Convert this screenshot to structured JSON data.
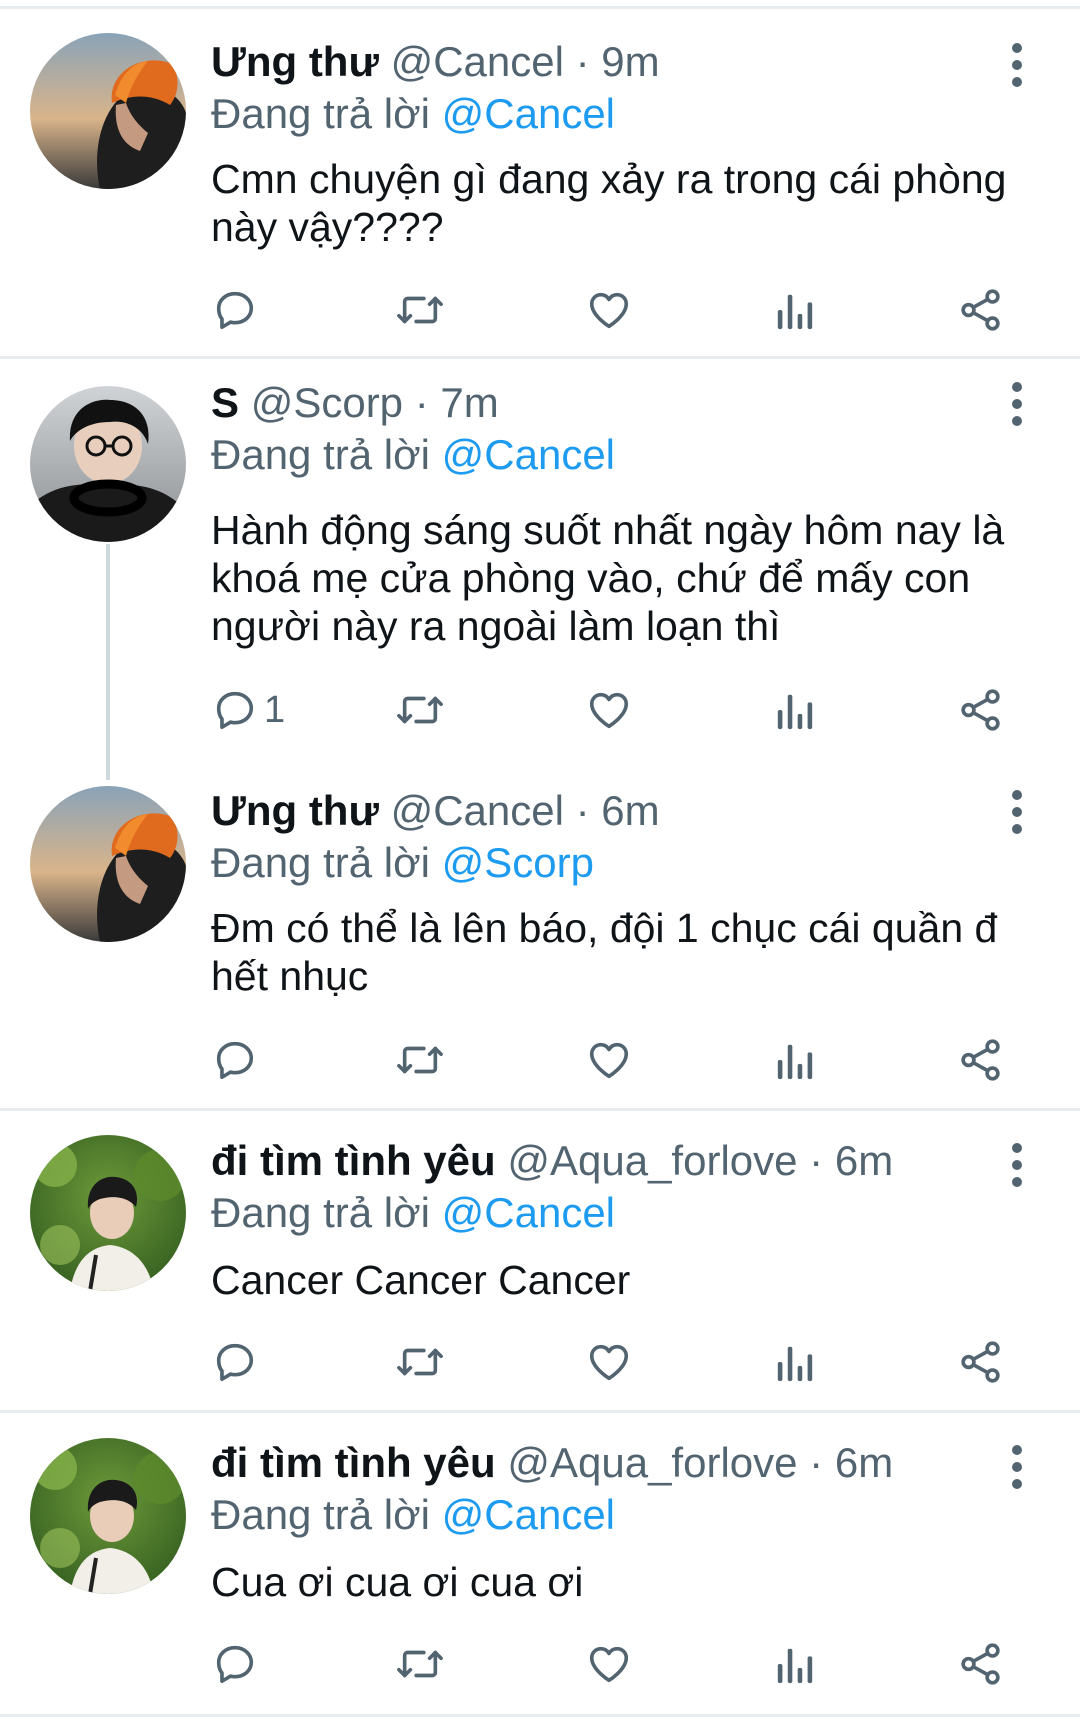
{
  "tweets": [
    {
      "name": "Ưng thư",
      "handle": "@Cancel",
      "separator": "·",
      "time": "9m",
      "replying_label": "Đang trả lời",
      "replying_to": "@Cancel",
      "text": "Cmn chuyện gì đang xảy ra trong cái phòng này vậy????",
      "reply_count": "",
      "avatar_icon": "avatar-orange-hair"
    },
    {
      "name": "S",
      "handle": "@Scorp",
      "separator": "·",
      "time": "7m",
      "replying_label": "Đang trả lời",
      "replying_to": "@Cancel",
      "text": "Hành động sáng suốt nhất ngày hôm nay là khoá mẹ cửa phòng vào, chứ để mấy con người này ra ngoài làm loạn thì",
      "reply_count": "1",
      "avatar_icon": "avatar-glasses"
    },
    {
      "name": "Ưng thư",
      "handle": "@Cancel",
      "separator": "·",
      "time": "6m",
      "replying_label": "Đang trả lời",
      "replying_to": "@Scorp",
      "text": "Đm có thể là lên báo, đội 1 chục cái quần đ hết nhục",
      "reply_count": "",
      "avatar_icon": "avatar-orange-hair"
    },
    {
      "name": "đi tìm tình yêu",
      "handle": "@Aqua_forlove",
      "separator": "·",
      "time": "6m",
      "replying_label": "Đang trả lời",
      "replying_to": "@Cancel",
      "text": "Cancer Cancer Cancer",
      "reply_count": "",
      "avatar_icon": "avatar-green-trees"
    },
    {
      "name": "đi tìm tình yêu",
      "handle": "@Aqua_forlove",
      "separator": "·",
      "time": "6m",
      "replying_label": "Đang trả lời",
      "replying_to": "@Cancel",
      "text": "Cua ơi cua ơi cua ơi",
      "reply_count": "",
      "avatar_icon": "avatar-green-trees"
    }
  ],
  "action_icons": [
    "reply-icon",
    "retweet-icon",
    "like-icon",
    "analytics-icon",
    "share-icon"
  ],
  "colors": {
    "text": "#0f1419",
    "secondary": "#536471",
    "mention": "#1d9bf0",
    "divider": "#e6ecf0",
    "icon": "#536471"
  }
}
